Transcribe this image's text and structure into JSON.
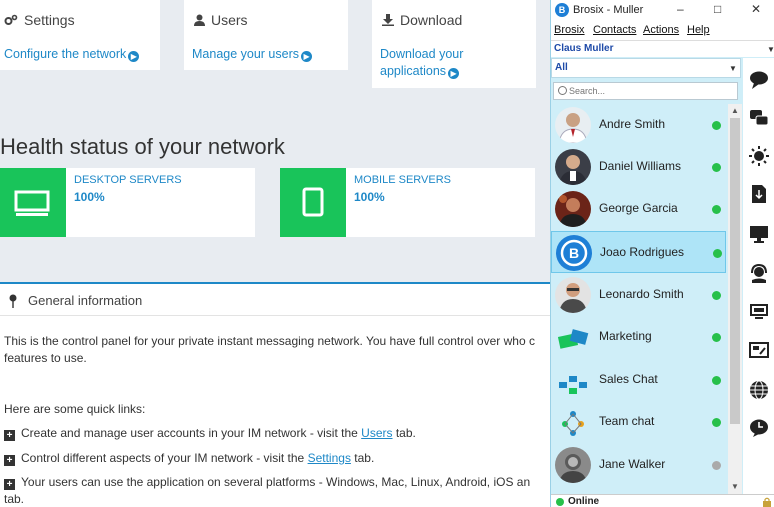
{
  "admin": {
    "cards": [
      {
        "title": "Settings",
        "icon": "gears-icon",
        "link": "Configure the network"
      },
      {
        "title": "Users",
        "icon": "user-icon",
        "link": "Manage your users"
      },
      {
        "title": "Download",
        "icon": "download-icon",
        "link_line1": "Download your",
        "link_line2": "applications"
      }
    ],
    "health_title": "Health status of your network",
    "stats": [
      {
        "label": "DESKTOP SERVERS",
        "value": "100%"
      },
      {
        "label": "MOBILE SERVERS",
        "value": "100%"
      }
    ],
    "general": {
      "title": "General information",
      "intro_line1": "This is the control panel for your private instant messaging network. You have full control over who c",
      "intro_line2": "features to use.",
      "quick_links_heading": "Here are some quick links:",
      "items": [
        {
          "pre": "Create and manage user accounts in your IM network - visit the ",
          "link": "Users",
          "post": " tab."
        },
        {
          "pre": "Control different aspects of your IM network - visit the ",
          "link": "Settings",
          "post": " tab."
        },
        {
          "pre": "Your users can use the application on several platforms - Windows, Mac, Linux, Android, iOS an",
          "link": "",
          "post": ""
        }
      ],
      "tail": "tab."
    },
    "accent_color": "#1e88c7",
    "status_green": "#19c45a"
  },
  "brosix": {
    "window_title": "Brosix - Muller",
    "menu": [
      "Brosix",
      "Contacts",
      "Actions",
      "Help"
    ],
    "user": "Claus Muller",
    "filter": "All",
    "search_placeholder": "Search...",
    "contacts": [
      {
        "name": "Andre Smith",
        "status": "online"
      },
      {
        "name": "Daniel Williams",
        "status": "online"
      },
      {
        "name": "George Garcia",
        "status": "online"
      },
      {
        "name": "Joao Rodrigues",
        "status": "online",
        "selected": true
      },
      {
        "name": "Leonardo Smith",
        "status": "online"
      },
      {
        "name": "Marketing",
        "status": "online"
      },
      {
        "name": "Sales Chat",
        "status": "online"
      },
      {
        "name": "Team chat",
        "status": "online"
      },
      {
        "name": "Jane Walker",
        "status": "offline"
      }
    ],
    "sidebar_icons": [
      "chat-bubble-icon",
      "group-chat-icon",
      "sun-icon",
      "file-transfer-icon",
      "screen-share-icon",
      "support-headset-icon",
      "remote-desktop-icon",
      "whiteboard-icon",
      "globe-icon",
      "history-icon"
    ],
    "status_text": "Online",
    "online_color": "#27c04a",
    "offline_color": "#aaaaaa"
  }
}
